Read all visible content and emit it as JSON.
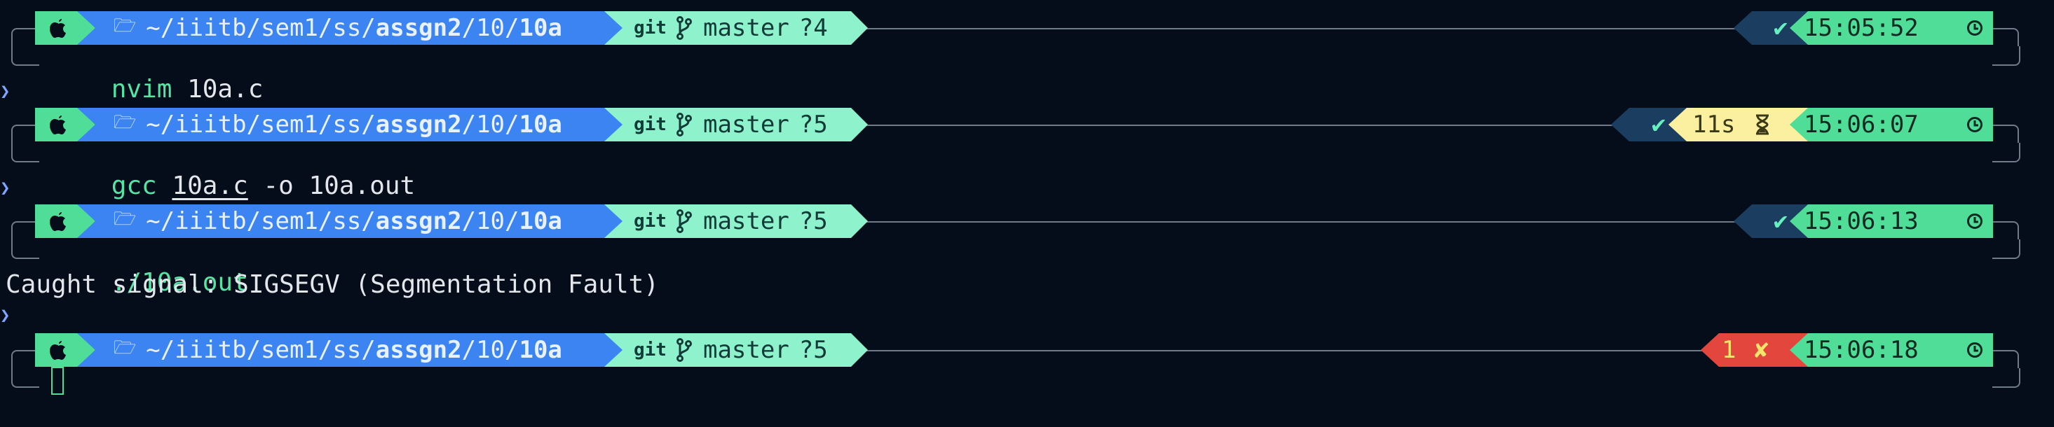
{
  "prompts": [
    {
      "path": {
        "prefix": "~/iiitb/sem1/ss/",
        "bold_dir": "assgn2",
        "mid": "/10/",
        "last": "10a"
      },
      "git": {
        "vcs": "git",
        "branch": "master",
        "untracked": "?4"
      },
      "status": {
        "ok": "✔",
        "time": "15:05:52"
      },
      "command": {
        "cmd": "nvim",
        "args": " 10a.c"
      }
    },
    {
      "path": {
        "prefix": "~/iiitb/sem1/ss/",
        "bold_dir": "assgn2",
        "mid": "/10/",
        "last": "10a"
      },
      "git": {
        "vcs": "git",
        "branch": "master",
        "untracked": "?5"
      },
      "status": {
        "ok": "✔",
        "duration": "11s",
        "time": "15:06:07"
      },
      "command": {
        "cmd": "gcc",
        "file": "10a.c",
        "args": " -o 10a.out"
      }
    },
    {
      "path": {
        "prefix": "~/iiitb/sem1/ss/",
        "bold_dir": "assgn2",
        "mid": "/10/",
        "last": "10a"
      },
      "git": {
        "vcs": "git",
        "branch": "master",
        "untracked": "?5"
      },
      "status": {
        "ok": "✔",
        "time": "15:06:13"
      },
      "command": {
        "cmd": "./10a.out"
      },
      "output": "Caught signal: SIGSEGV (Segmentation Fault)"
    },
    {
      "path": {
        "prefix": "~/iiitb/sem1/ss/",
        "bold_dir": "assgn2",
        "mid": "/10/",
        "last": "10a"
      },
      "git": {
        "vcs": "git",
        "branch": "master",
        "untracked": "?5"
      },
      "status": {
        "exit_code": "1",
        "err_mark": "✘",
        "time": "15:06:18"
      }
    }
  ],
  "icons": {
    "os": "apple-icon",
    "folder": "folder-icon",
    "branch": "git-branch-icon",
    "clock": "clock-icon",
    "hourglass": "hourglass-icon"
  },
  "colors": {
    "background": "#050d1a",
    "os_segment": "#4fdd98",
    "path_segment": "#3b84f1",
    "git_segment": "#8ef3cc",
    "ok_segment": "#1b3d5f",
    "duration_segment": "#fbf0a0",
    "error_segment": "#e3463d"
  }
}
